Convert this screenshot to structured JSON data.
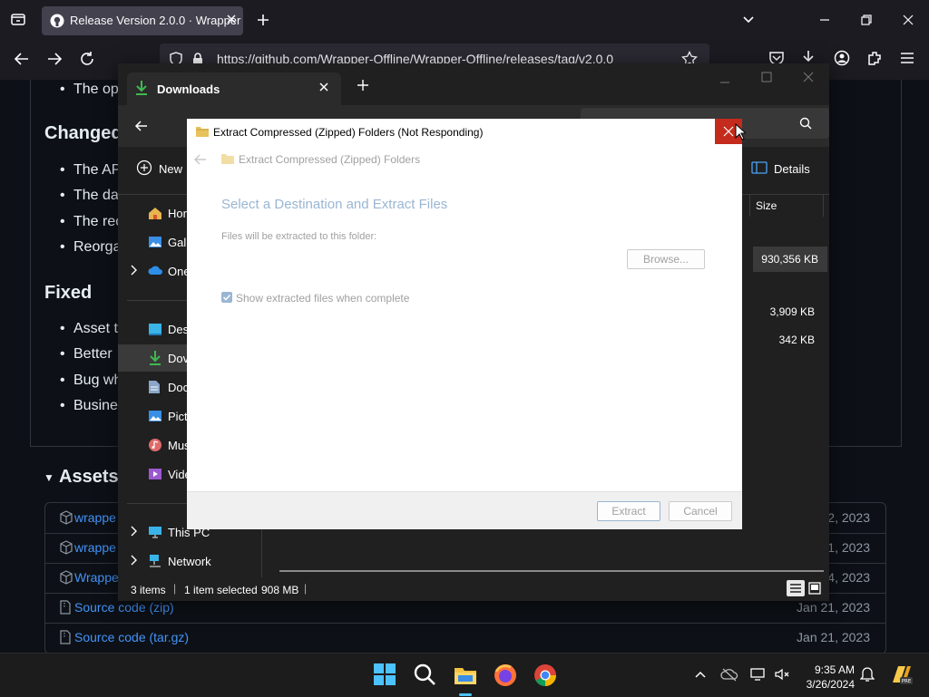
{
  "browser": {
    "tab_title": "Release Version 2.0.0 · Wrapper",
    "url": "https://github.com/Wrapper-Offline/Wrapper-Offline/releases/tag/v2.0.0"
  },
  "github": {
    "top_bullet": "The op",
    "changed_heading": "Changed",
    "changed_bullets": [
      "The AP",
      "The da",
      "The rec",
      "Reorga"
    ],
    "fixed_heading": "Fixed",
    "fixed_bullets": [
      "Asset t",
      "Better",
      "Bug wh",
      "Busines"
    ],
    "assets_heading": "Assets",
    "assets": [
      {
        "name": "wrappe",
        "date": "2, 2023"
      },
      {
        "name": "wrappe",
        "date": "1, 2023"
      },
      {
        "name": "Wrappe",
        "date": "4, 2023"
      },
      {
        "name": "Source code (zip)",
        "date": "Jan 21, 2023"
      },
      {
        "name": "Source code (tar.gz)",
        "date": "Jan 21, 2023"
      }
    ]
  },
  "explorer": {
    "tab_title": "Downloads",
    "new_label": "New",
    "details_label": "Details",
    "size_header": "Size",
    "sizes": [
      "930,356 KB",
      "3,909 KB",
      "342 KB"
    ],
    "nav_items": [
      {
        "label": "Hor",
        "icon": "home-icon"
      },
      {
        "label": "Gall",
        "icon": "gallery-icon"
      },
      {
        "label": "One",
        "icon": "onedrive-icon"
      },
      {
        "label": "Des",
        "icon": "desktop-icon"
      },
      {
        "label": "Dov",
        "icon": "downloads-icon"
      },
      {
        "label": "Doc",
        "icon": "documents-icon"
      },
      {
        "label": "Pict",
        "icon": "pictures-icon"
      },
      {
        "label": "Mus",
        "icon": "music-icon"
      },
      {
        "label": "Vide",
        "icon": "videos-icon"
      },
      {
        "label": "This PC",
        "icon": "this-pc-icon"
      },
      {
        "label": "Network",
        "icon": "network-icon"
      }
    ],
    "status_items": "3 items",
    "status_selected": "1 item selected",
    "status_size": "908 MB"
  },
  "dialog": {
    "title": "Extract Compressed (Zipped) Folders (Not Responding)",
    "breadcrumb": "Extract Compressed (Zipped) Folders",
    "heading": "Select a Destination and Extract Files",
    "folder_label": "Files will be extracted to this folder:",
    "browse_label": "Browse...",
    "checkbox_label": "Show extracted files when complete",
    "extract_label": "Extract",
    "cancel_label": "Cancel"
  },
  "taskbar": {
    "time": "9:35 AM",
    "date": "3/26/2024"
  },
  "colors": {
    "accent_close": "#c42b1c",
    "link": "#4493f8",
    "github_bg": "#0d1117"
  }
}
